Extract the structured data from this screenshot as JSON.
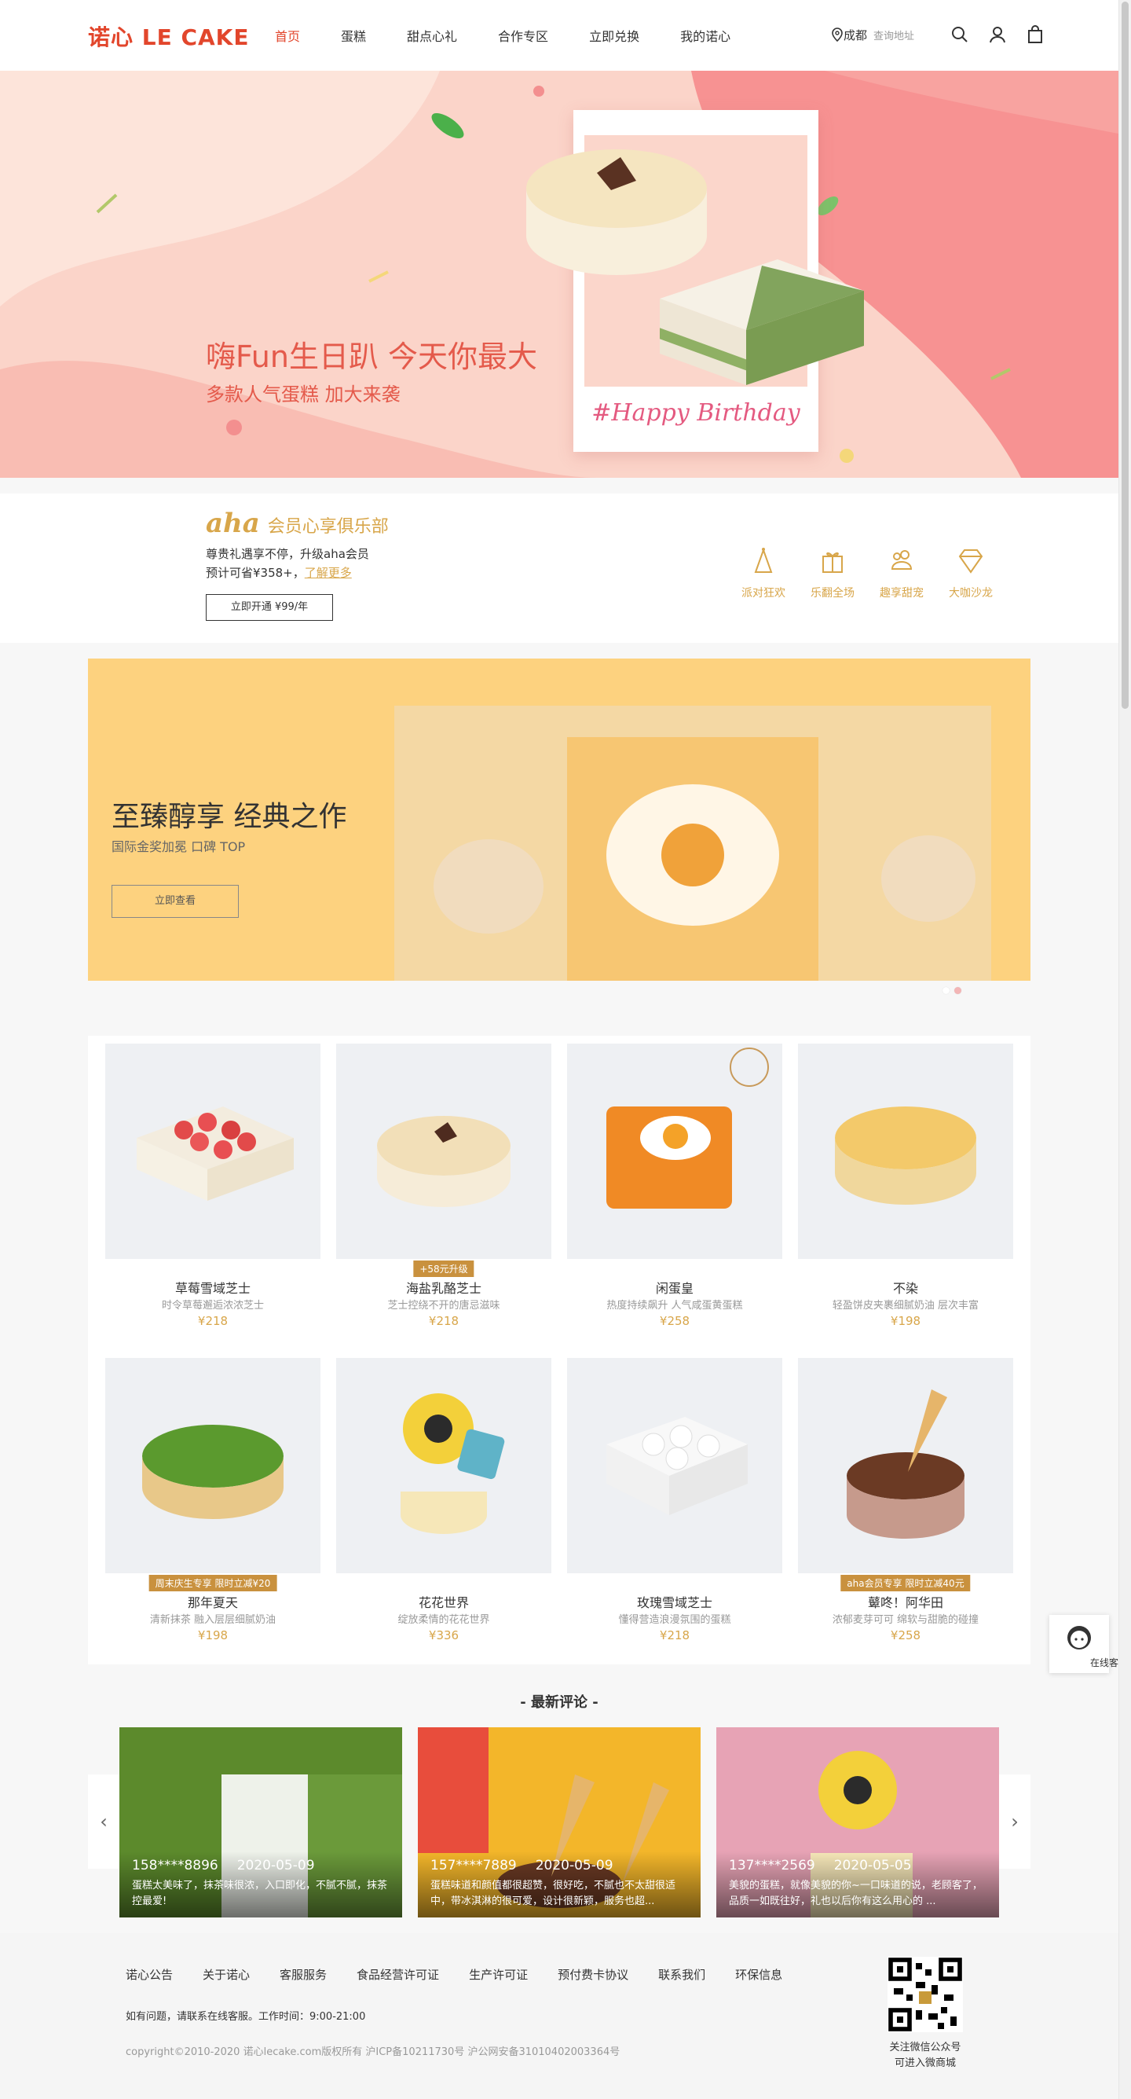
{
  "header": {
    "logo": "诺心 LE CAKE",
    "nav": [
      "首页",
      "蛋糕",
      "甜点心礼",
      "合作专区",
      "立即兑换",
      "我的诺心"
    ],
    "city": "成都",
    "city_hint": "查询地址"
  },
  "hero": {
    "title": "嗨Fun生日趴 今天你最大",
    "subtitle": "多款人气蛋糕 加大来袭",
    "card_text": "#Happy Birthday"
  },
  "aha": {
    "logo": "aha",
    "title": "会员心享俱乐部",
    "line1": "尊贵礼遇享不停，升级aha会员",
    "line2": "预计可省¥358+，",
    "learn_more": "了解更多",
    "button": "立即开通 ¥99/年",
    "perks": [
      "派对狂欢",
      "乐翻全场",
      "趣享甜宠",
      "大咖沙龙"
    ]
  },
  "feature": {
    "title": "至臻醇享 经典之作",
    "subtitle": "国际金奖加冕 口碑 TOP",
    "button": "立即查看"
  },
  "products": [
    {
      "name": "草莓雪域芝士",
      "desc": "时令草莓邂逅浓浓芝士",
      "price": "¥218",
      "tag": ""
    },
    {
      "name": "海盐乳酪芝士",
      "desc": "芝士控绕不开的唐忌滋味",
      "price": "¥218",
      "tag": "+58元升级"
    },
    {
      "name": "闲蛋皇",
      "desc": "热度持续飙升 人气咸蛋黄蛋糕",
      "price": "¥258",
      "tag": ""
    },
    {
      "name": "不染",
      "desc": "轻盈饼皮夹裹细腻奶油 层次丰富",
      "price": "¥198",
      "tag": ""
    },
    {
      "name": "那年夏天",
      "desc": "清新抹茶 融入层层细腻奶油",
      "price": "¥198",
      "tag": "周末庆生专享 限时立减¥20"
    },
    {
      "name": "花花世界",
      "desc": "绽放柔情的花花世界",
      "price": "¥336",
      "tag": ""
    },
    {
      "name": "玫瑰雪域芝士",
      "desc": "懂得营造浪漫氛围的蛋糕",
      "price": "¥218",
      "tag": ""
    },
    {
      "name": "鼙咚！阿华田",
      "desc": "浓郁麦芽可可 绵软与甜脆的碰撞",
      "price": "¥258",
      "tag": "aha会员专享 限时立减40元"
    }
  ],
  "service": {
    "label": "在线客服"
  },
  "reviews": {
    "title": "- 最新评论 -",
    "items": [
      {
        "user": "158****8896",
        "date": "2020-05-09",
        "text": "蛋糕太美味了，抹茶味很浓，入口即化，不腻不腻，抹茶控最爱!"
      },
      {
        "user": "157****7889",
        "date": "2020-05-09",
        "text": "蛋糕味道和颜值都很超赞，很好吃，不腻也不太甜很适中，带冰淇淋的很可爱，设计很新颖，服务也超..."
      },
      {
        "user": "137****2569",
        "date": "2020-05-05",
        "text": "美貌的蛋糕，就像美貌的你~一口味道的说，老顾客了，品质一如既往好，礼也以后你有这么用心的 ..."
      }
    ]
  },
  "footer": {
    "links": [
      "诺心公告",
      "关于诺心",
      "客服服务",
      "食品经营许可证",
      "生产许可证",
      "预付费卡协议",
      "联系我们",
      "环保信息"
    ],
    "help": "如有问题，请联系在线客服。工作时间：9:00-21:00",
    "copyright": "copyright©2010-2020 诺心lecake.com版权所有   沪ICP备10211730号   沪公网安备31010402003364号",
    "qr_label_1": "关注微信公众号",
    "qr_label_2": "可进入微商城"
  },
  "colors": {
    "brand": "#e2462c",
    "gold": "#d8a64a",
    "hero_bg": "#fbd4c9",
    "feature_bg": "#fdd27f"
  }
}
